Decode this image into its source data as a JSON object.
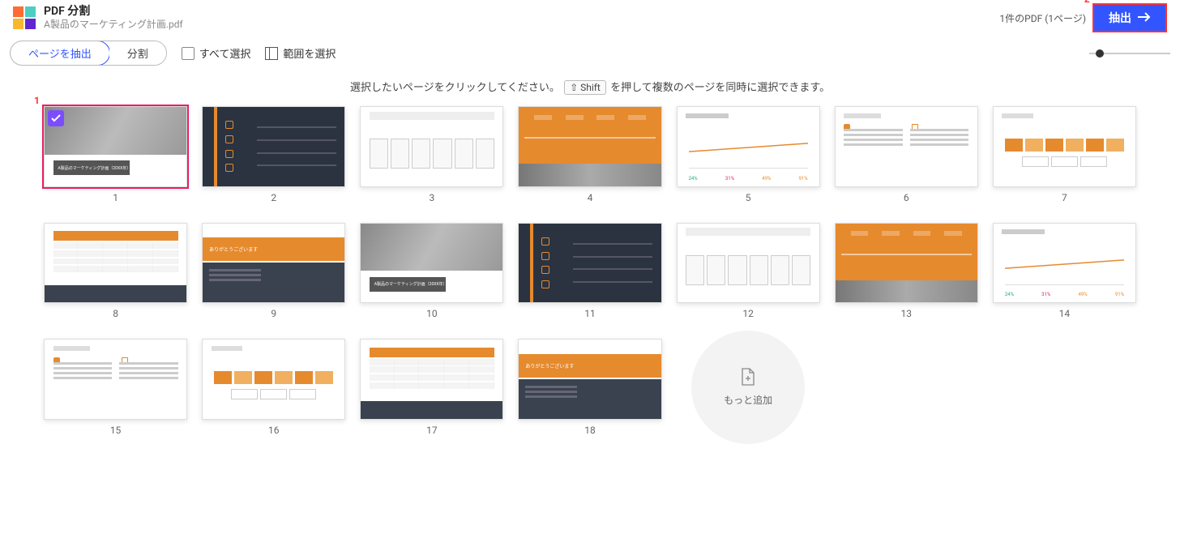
{
  "header": {
    "app_title": "PDF 分割",
    "file_name": "A製品のマーケティング計画.pdf",
    "status": "1件のPDF (1ページ)",
    "extract_label": "抽出"
  },
  "annotations": {
    "a1": "1",
    "a2": "2"
  },
  "toolbar": {
    "tab_extract": "ページを抽出",
    "tab_split": "分割",
    "select_all": "すべて選択",
    "select_range": "範囲を選択"
  },
  "instruction": {
    "pre": "選択したいページをクリックしてください。",
    "key": "⇧ Shift",
    "post": "を押して複数のページを同時に選択できます。"
  },
  "chart_pct": {
    "p1": "24%",
    "p2": "31%",
    "p3": "49%",
    "p4": "91%"
  },
  "slide_text": {
    "title_band": "A製品のマーケティング計画（20XX年）",
    "thanks": "ありがとうございます"
  },
  "pages": {
    "p1": "1",
    "p2": "2",
    "p3": "3",
    "p4": "4",
    "p5": "5",
    "p6": "6",
    "p7": "7",
    "p8": "8",
    "p9": "9",
    "p10": "10",
    "p11": "11",
    "p12": "12",
    "p13": "13",
    "p14": "14",
    "p15": "15",
    "p16": "16",
    "p17": "17",
    "p18": "18"
  },
  "addmore": {
    "label": "もっと追加"
  }
}
